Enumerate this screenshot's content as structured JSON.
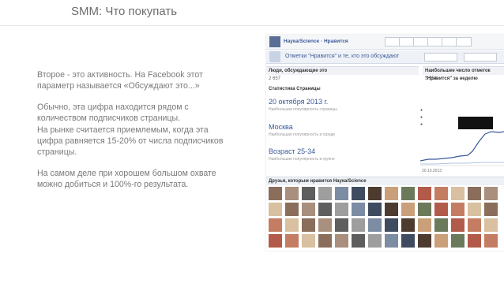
{
  "slide": {
    "title": "SMM: Что покупать",
    "paragraphs": [
      "Второе - это активность. На Facebook этот параметр называется «Обсуждают это...»",
      "Обычно, эта цифра находится рядом с количеством подписчиков страницы.",
      "На рынке считается приемлемым, когда эта цифра равняется 15-20% от числа подписчиков страницы.",
      "На самом деле при хорошем большом охвате можно добиться и 100%-го результата."
    ]
  },
  "screenshot": {
    "breadcrumb": "Наука/Science · Нравится",
    "tab_label": "Отметки \"Нравится\" и те, кто это обсуждают",
    "col1_header": "Люди, обсуждающие это",
    "col1_value": "2 657",
    "col2_header": "Наибольшее число отметок \"Нравится\" за неделю",
    "col2_value": "3 554",
    "section_title": "Статистика Страницы",
    "stats": [
      {
        "big": "20 октября 2013 г.",
        "note": "Наибольшая популярность страницы"
      },
      {
        "big": "Москва",
        "note": "Наибольшая популярность в городе"
      },
      {
        "big": "Возраст 25-34",
        "note": "Наибольшая популярность в группе"
      }
    ],
    "chart_date": "20.10.2013",
    "friends_header": "Друзья, которым нравится Наука/Science",
    "colors": {
      "fb_blue": "#3b5998",
      "fb_bar": "#f5f6f8",
      "text_gray": "#7a7a7a"
    }
  }
}
